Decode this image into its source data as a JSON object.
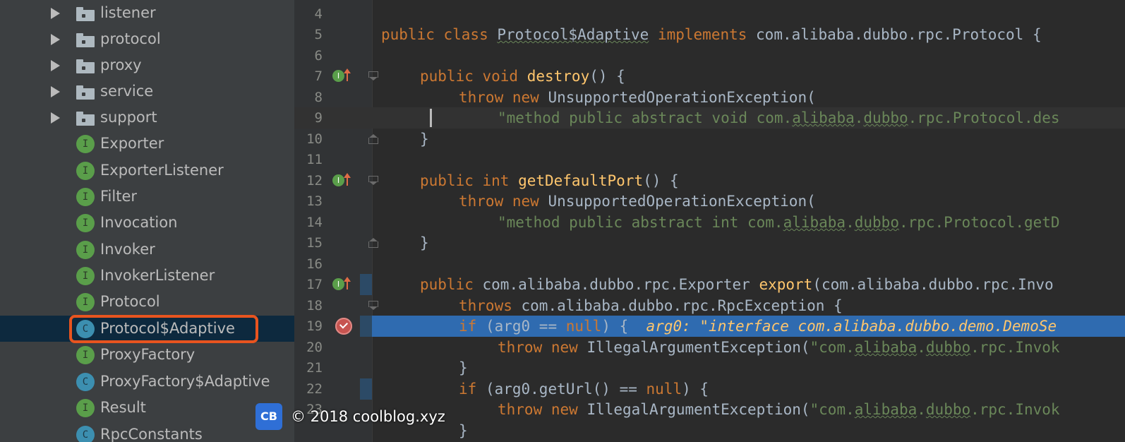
{
  "project_tree": {
    "folders": [
      "listener",
      "protocol",
      "proxy",
      "service",
      "support"
    ],
    "items": [
      {
        "label": "Exporter",
        "kind": "interface",
        "badge": "I"
      },
      {
        "label": "ExporterListener",
        "kind": "interface",
        "badge": "I"
      },
      {
        "label": "Filter",
        "kind": "interface",
        "badge": "I"
      },
      {
        "label": "Invocation",
        "kind": "interface",
        "badge": "I"
      },
      {
        "label": "Invoker",
        "kind": "interface",
        "badge": "I"
      },
      {
        "label": "InvokerListener",
        "kind": "interface",
        "badge": "I"
      },
      {
        "label": "Protocol",
        "kind": "interface",
        "badge": "I"
      },
      {
        "label": "Protocol$Adaptive",
        "kind": "class",
        "badge": "C",
        "selected": true,
        "highlighted": true
      },
      {
        "label": "ProxyFactory",
        "kind": "interface",
        "badge": "I"
      },
      {
        "label": "ProxyFactory$Adaptive",
        "kind": "class",
        "badge": "C"
      },
      {
        "label": "Result",
        "kind": "interface",
        "badge": "I"
      },
      {
        "label": "RpcConstants",
        "kind": "class",
        "badge": "C"
      }
    ]
  },
  "editor": {
    "lines": [
      {
        "n": "4"
      },
      {
        "n": "5",
        "p": [
          "public class ",
          "Protocol$Adaptive",
          " implements ",
          "com.alibaba.dubbo.rpc.Protocol {"
        ]
      },
      {
        "n": "6"
      },
      {
        "n": "7",
        "p": [
          "public void ",
          "destroy",
          "() {"
        ]
      },
      {
        "n": "8",
        "p": [
          "throw new ",
          "UnsupportedOperationException("
        ]
      },
      {
        "n": "9",
        "p": [
          "\"method public abstract void com.",
          "alibaba",
          ".",
          "dubbo",
          ".rpc.Protocol.des"
        ]
      },
      {
        "n": "10",
        "p": [
          "}"
        ]
      },
      {
        "n": "11"
      },
      {
        "n": "12",
        "p": [
          "public int ",
          "getDefaultPort",
          "() {"
        ]
      },
      {
        "n": "13",
        "p": [
          "throw new ",
          "UnsupportedOperationException("
        ]
      },
      {
        "n": "14",
        "p": [
          "\"method public abstract int com.",
          "alibaba",
          ".",
          "dubbo",
          ".rpc.Protocol.getD"
        ]
      },
      {
        "n": "15",
        "p": [
          "}"
        ]
      },
      {
        "n": "16"
      },
      {
        "n": "17",
        "p": [
          "public ",
          "com.alibaba.dubbo.rpc.Exporter ",
          "export",
          "(com.alibaba.dubbo.rpc.Invo"
        ]
      },
      {
        "n": "18",
        "p": [
          "throws ",
          "com.alibaba.dubbo.rpc.RpcException {"
        ]
      },
      {
        "n": "19",
        "p": [
          "if ",
          "(arg0 == ",
          "null",
          ") {",
          "arg0: \"interface com.alibaba.dubbo.demo.DemoSe"
        ]
      },
      {
        "n": "20",
        "p": [
          "throw new ",
          "IllegalArgumentException(",
          "\"com.",
          "alibaba",
          ".",
          "dubbo",
          ".rpc.Invok"
        ]
      },
      {
        "n": "21",
        "p": [
          "}"
        ]
      },
      {
        "n": "22",
        "p": [
          "if ",
          "(arg0.getUrl() == ",
          "null",
          ") {"
        ]
      },
      {
        "n": "23",
        "p": [
          "throw new ",
          "IllegalArgumentException(",
          "\"com.",
          "alibaba",
          ".",
          "dubbo",
          ".rpc.Invok"
        ]
      },
      {
        "n": "",
        "p": [
          "}"
        ]
      }
    ]
  },
  "watermark": {
    "logo": "CB",
    "text": "© 2018 coolblog.xyz"
  },
  "colors": {
    "keyword": "#cc7832",
    "method": "#ffc66d",
    "string": "#6a8759",
    "current_line": "#2f6bb0",
    "highlight_box": "#e8541f"
  },
  "icons": [
    "expand-arrow-icon",
    "folder-icon",
    "interface-icon",
    "class-icon",
    "implements-icon",
    "breakpoint-icon",
    "fold-icon"
  ]
}
